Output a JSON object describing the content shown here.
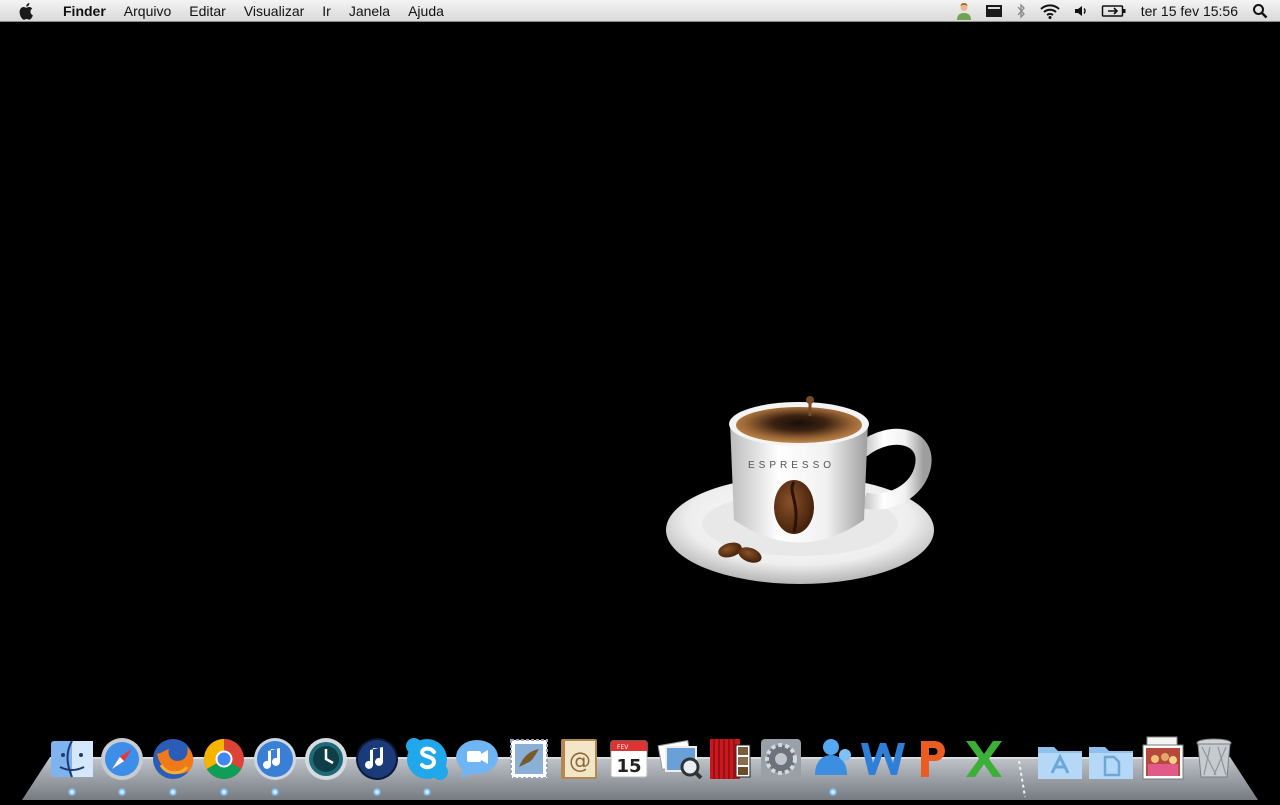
{
  "menubar": {
    "app_name": "Finder",
    "menus": [
      "Arquivo",
      "Editar",
      "Visualizar",
      "Ir",
      "Janela",
      "Ajuda"
    ],
    "clock": "ter 15 fev  15:56",
    "status_icons": [
      "user-icon",
      "display-icon",
      "bluetooth-icon",
      "wifi-icon",
      "volume-icon",
      "battery-icon",
      "spotlight-icon"
    ]
  },
  "wallpaper": {
    "cup_text": "ESPRESSO"
  },
  "dock": {
    "apps": [
      "Finder",
      "Safari",
      "Firefox",
      "Google Chrome",
      "iTunes",
      "Time Machine",
      "iTunes",
      "Skype",
      "iChat",
      "Mail",
      "Address Book",
      "iCal",
      "Preview",
      "Photo Booth",
      "System Preferences",
      "Messenger",
      "Word",
      "PowerPoint",
      "Excel"
    ],
    "calendar": {
      "month": "FEV",
      "day": "15"
    },
    "folders": [
      "Applications",
      "Documents"
    ],
    "stack": "Photos",
    "trash": "Trash"
  },
  "colors": {
    "menubar": "#e8e8e8",
    "desktop": "#000000",
    "indicator": "#7fc4ff"
  }
}
